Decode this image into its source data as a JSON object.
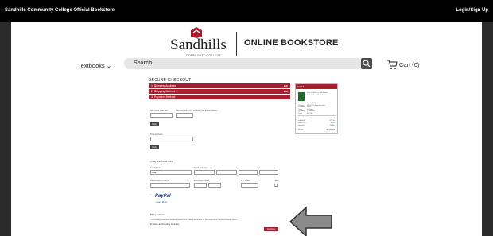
{
  "topbar": {
    "site_title": "Sandhills Community College Official Bookstore",
    "login": "Login/Sign Up"
  },
  "logo": {
    "name": "Sandhills",
    "sub": "COMMUNITY COLLEGE",
    "store": "ONLINE BOOKSTORE"
  },
  "nav": {
    "textbooks": "Textbooks",
    "search_placeholder": "Search",
    "cart": "Cart (0)"
  },
  "colors": {
    "brand": "#a4202f",
    "topbar": "#000000"
  },
  "checkout": {
    "title": "SECURE CHECKOUT",
    "steps": [
      {
        "label": "1. Shipping Address",
        "edit": "Edit"
      },
      {
        "label": "2. Shipping Method",
        "edit": "Edit"
      },
      {
        "label": "3. Payment Method",
        "edit": ""
      }
    ],
    "gift_card_label": "Gift Card Number",
    "security_pin_label": "Security PIN (If a security pin listed below)",
    "apply_1": "Apply",
    "promo_label": "Promo Code",
    "apply_2": "Apply",
    "pay_option": "Pay with Credit Card",
    "card_type_label": "Card Type",
    "card_type_value": "Visa",
    "card_number_label": "Card Number",
    "cardholder_label": "Cardholder's Name",
    "expiration_label": "Expiration Date",
    "zip_label": "ZIP Code",
    "save_label": "Save",
    "paypal": "PayPal",
    "paypal_sub": "Learn More",
    "billing_title": "Billing Address",
    "billing_note": "Your billing address should match the billing address of the payment method being used.",
    "same_as_shipping": "Same as Shipping Address",
    "continue": "Continue"
  },
  "cart_panel": {
    "title": "CART",
    "item_title": "The St. Martin's Handbook",
    "item_sub": "Sixth With 2016 MLA",
    "detail_labels": [
      "Semester",
      "Course",
      "Condition",
      "Type",
      "Quantity",
      "Price"
    ],
    "detail_values": [
      "Spring 2020",
      "ENG 111 Writing/Inquiry",
      "NEW",
      "In Store",
      "1 Remove",
      "$71.35"
    ],
    "summary_labels": [
      "Items in Cart",
      "Subtotal",
      "Sales Tax",
      "Shipping",
      "Total"
    ],
    "summary_values": [
      "1",
      "$71.35",
      "$0.00",
      "FREE",
      "$118.22"
    ]
  }
}
